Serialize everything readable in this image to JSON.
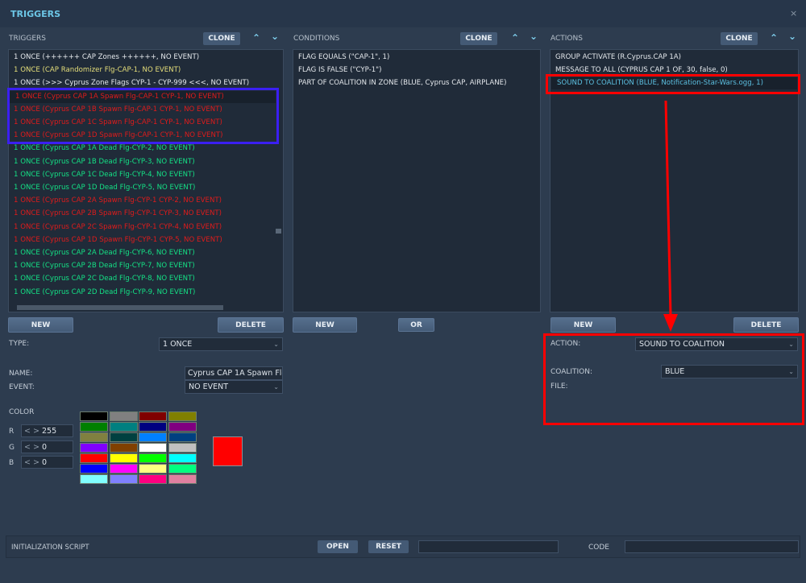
{
  "window": {
    "title": "TRIGGERS",
    "close": "×"
  },
  "triggers": {
    "label": "TRIGGERS",
    "clone": "CLONE",
    "up": "^",
    "down": "v",
    "new": "NEW",
    "delete": "DELETE",
    "items": [
      {
        "text": "1 ONCE (++++++ CAP Zones ++++++, NO EVENT)",
        "color": "#e4e8ec"
      },
      {
        "text": "1 ONCE (CAP Randomizer Flg-CAP-1, NO EVENT)",
        "color": "#e6df7a"
      },
      {
        "text": "1 ONCE (>>> Cyprus Zone Flags CYP-1 - CYP-999 <<<, NO EVENT)",
        "color": "#e4e8ec"
      },
      {
        "text": "1 ONCE (Cyprus CAP 1A Spawn Flg-CAP-1 CYP-1, NO EVENT)",
        "color": "#e01b1b",
        "selected": true
      },
      {
        "text": "1 ONCE (Cyprus CAP 1B Spawn Flg-CAP-1 CYP-1, NO EVENT)",
        "color": "#e01b1b"
      },
      {
        "text": "1 ONCE (Cyprus CAP 1C Spawn Flg-CAP-1 CYP-1, NO EVENT)",
        "color": "#e01b1b"
      },
      {
        "text": "1 ONCE (Cyprus CAP 1D Spawn Flg-CAP-1 CYP-1, NO EVENT)",
        "color": "#e01b1b"
      },
      {
        "text": "1 ONCE (Cyprus CAP 1A Dead Flg-CYP-2, NO EVENT)",
        "color": "#14e085"
      },
      {
        "text": "1 ONCE (Cyprus CAP 1B Dead Flg-CYP-3, NO EVENT)",
        "color": "#14e085"
      },
      {
        "text": "1 ONCE (Cyprus CAP 1C Dead Flg-CYP-4, NO EVENT)",
        "color": "#14e085"
      },
      {
        "text": "1 ONCE (Cyprus CAP 1D Dead Flg-CYP-5, NO EVENT)",
        "color": "#14e085"
      },
      {
        "text": "1 ONCE (Cyprus CAP 2A Spawn Flg-CYP-1 CYP-2, NO EVENT)",
        "color": "#e01b1b"
      },
      {
        "text": "1 ONCE (Cyprus CAP 2B Spawn Flg-CYP-1 CYP-3, NO EVENT)",
        "color": "#e01b1b"
      },
      {
        "text": "1 ONCE (Cyprus CAP 2C Spawn Flg-CYP-1 CYP-4, NO EVENT)",
        "color": "#e01b1b"
      },
      {
        "text": "1 ONCE (Cyprus CAP 1D Spawn Flg-CYP-1 CYP-5, NO EVENT)",
        "color": "#e01b1b"
      },
      {
        "text": "1 ONCE (Cyprus CAP 2A Dead Flg-CYP-6, NO EVENT)",
        "color": "#14e085"
      },
      {
        "text": "1 ONCE (Cyprus CAP 2B Dead Flg-CYP-7, NO EVENT)",
        "color": "#14e085"
      },
      {
        "text": "1 ONCE (Cyprus CAP 2C Dead Flg-CYP-8, NO EVENT)",
        "color": "#14e085"
      },
      {
        "text": "1 ONCE (Cyprus CAP 2D Dead Flg-CYP-9, NO EVENT)",
        "color": "#14e085"
      }
    ]
  },
  "conditions": {
    "label": "CONDITIONS",
    "clone": "CLONE",
    "new": "NEW",
    "or": "OR",
    "items": [
      "FLAG EQUALS (\"CAP-1\", 1)",
      "FLAG IS FALSE (\"CYP-1\")",
      "PART OF COALITION IN ZONE (BLUE, Cyprus CAP, AIRPLANE)"
    ]
  },
  "actions": {
    "label": "ACTIONS",
    "clone": "CLONE",
    "new": "NEW",
    "delete": "DELETE",
    "items": [
      {
        "text": "GROUP ACTIVATE (R.Cyprus.CAP 1A)"
      },
      {
        "text": "MESSAGE TO ALL (CYPRUS CAP 1 OF, 30, false, 0)"
      },
      {
        "text": "SOUND TO COALITION (BLUE, Notification-Star-Wars.ogg, 1)",
        "selected": true
      }
    ],
    "action_label": "ACTION:",
    "action_value": "SOUND TO COALITION",
    "coalition_label": "COALITION:",
    "coalition_value": "BLUE",
    "file_label": "FILE:"
  },
  "trigger_props": {
    "type_label": "TYPE:",
    "type_value": "1 ONCE",
    "name_label": "NAME:",
    "name_value": "Cyprus CAP 1A Spawn Flg-",
    "event_label": "EVENT:",
    "event_value": "NO EVENT"
  },
  "color": {
    "label": "COLOR",
    "r_label": "R",
    "g_label": "G",
    "b_label": "B",
    "r": "255",
    "g": "0",
    "b": "0",
    "stepper": "< >",
    "preview": "#ff0000",
    "palette": [
      "#000000",
      "#808080",
      "#800000",
      "#808000",
      "#008000",
      "#008080",
      "#000080",
      "#800080",
      "#808040",
      "#004040",
      "#0080ff",
      "#004080",
      "#8000ff",
      "#804000",
      "#ffffff",
      "#c0c0c0",
      "#ff0000",
      "#ffff00",
      "#00ff00",
      "#00ffff",
      "#0000ff",
      "#ff00ff",
      "#ffff80",
      "#00ff80",
      "#80ffff",
      "#8080ff",
      "#ff0080",
      "#e080a0"
    ]
  },
  "footer": {
    "init_label": "INITIALIZATION SCRIPT",
    "open": "OPEN",
    "reset": "RESET",
    "code_label": "CODE"
  },
  "annotation_colors": {
    "blue_box": "#3b1ff2",
    "red_box": "#ff0000"
  }
}
